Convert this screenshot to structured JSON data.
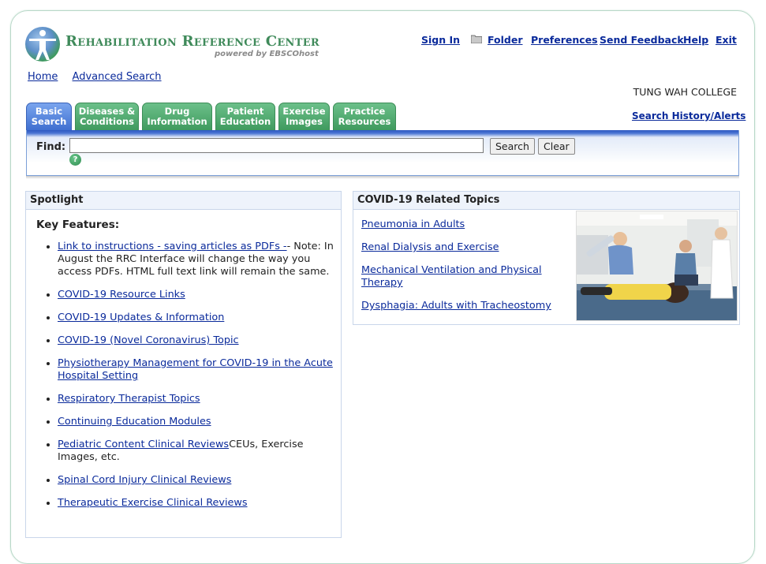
{
  "brand": {
    "title": "Rehabilitation Reference Center",
    "powered_by": "powered by EBSCOhost"
  },
  "top_nav": {
    "sign_in": "Sign In",
    "folder": "Folder",
    "preferences": "Preferences",
    "send_feedback": "Send Feedback",
    "help": "Help",
    "exit": "Exit"
  },
  "sub_nav": {
    "home": "Home",
    "advanced_search": "Advanced Search"
  },
  "institution": "TUNG WAH COLLEGE",
  "search_history_link": "Search History/Alerts",
  "tabs": [
    {
      "line1": "Basic",
      "line2": "Search",
      "active": true
    },
    {
      "line1": "Diseases &",
      "line2": "Conditions",
      "active": false
    },
    {
      "line1": "Drug",
      "line2": "Information",
      "active": false
    },
    {
      "line1": "Patient",
      "line2": "Education",
      "active": false
    },
    {
      "line1": "Exercise",
      "line2": "Images",
      "active": false
    },
    {
      "line1": "Practice",
      "line2": "Resources",
      "active": false
    }
  ],
  "search": {
    "find_label": "Find:",
    "value": "",
    "search_button": "Search",
    "clear_button": "Clear",
    "help_glyph": "?"
  },
  "spotlight": {
    "heading": "Spotlight",
    "subheading": "Key Features:",
    "items": [
      {
        "link": "Link to instructions - saving articles as PDFs -",
        "text": "- Note: In August the RRC Interface will change the way you access PDFs. HTML full text link will remain the same."
      },
      {
        "link": "COVID-19 Resource Links",
        "text": ""
      },
      {
        "link": "COVID-19 Updates & Information",
        "text": ""
      },
      {
        "link": "COVID-19 (Novel Coronavirus) Topic",
        "text": ""
      },
      {
        "link": "Physiotherapy Management for COVID-19 in the Acute Hospital Setting",
        "text": ""
      },
      {
        "link": "Respiratory Therapist Topics",
        "text": ""
      },
      {
        "link": "Continuing Education Modules",
        "text": ""
      },
      {
        "link": "Pediatric Content Clinical Reviews",
        "text": "CEUs, Exercise Images, etc."
      },
      {
        "link": "Spinal Cord Injury Clinical Reviews",
        "text": ""
      },
      {
        "link": "Therapeutic Exercise Clinical Reviews",
        "text": ""
      }
    ]
  },
  "covid_topics": {
    "heading": "COVID-19 Related Topics",
    "items": [
      "Pneumonia in Adults",
      "Renal Dialysis and Exercise",
      "Mechanical Ventilation and Physical Therapy",
      "Dysphagia: Adults with Tracheostomy"
    ]
  },
  "colors": {
    "link": "#0a2a9b",
    "brand_green": "#3f8a5a",
    "tab_green": "#4fa86b",
    "tab_active_blue": "#4a78d8",
    "panel_border": "#c9d6ea"
  }
}
